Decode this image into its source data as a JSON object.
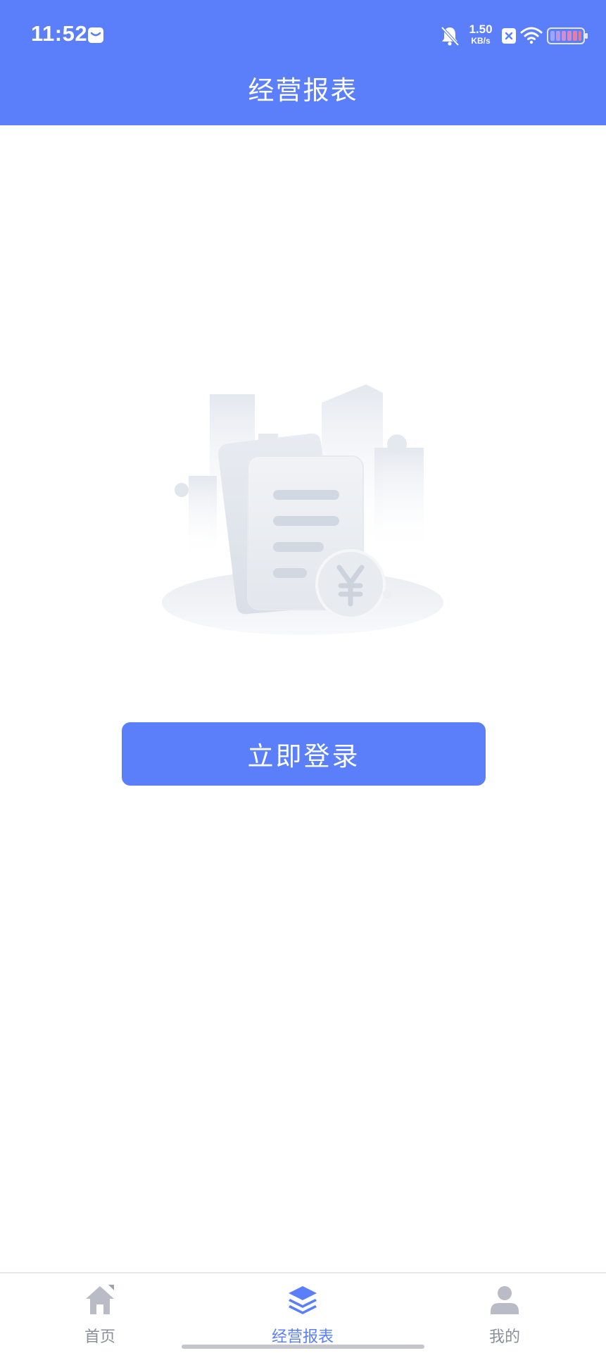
{
  "status_bar": {
    "time": "11:52",
    "net_speed_value": "1.50",
    "net_speed_unit": "KB/s",
    "icons": [
      "message-icon",
      "bell-mute-icon",
      "close-box-icon",
      "wifi-icon",
      "battery-icon"
    ]
  },
  "header": {
    "title": "经营报表"
  },
  "main": {
    "illustration": "empty-report-illustration",
    "login_button_label": "立即登录"
  },
  "tab_bar": {
    "tabs": [
      {
        "label": "首页",
        "icon": "home-icon",
        "active": false
      },
      {
        "label": "经营报表",
        "icon": "layers-icon",
        "active": true
      },
      {
        "label": "我的",
        "icon": "user-icon",
        "active": false
      }
    ]
  },
  "colors": {
    "accent": "#5b7ffa",
    "inactive_tab": "#8a8f99",
    "background": "#ffffff"
  }
}
